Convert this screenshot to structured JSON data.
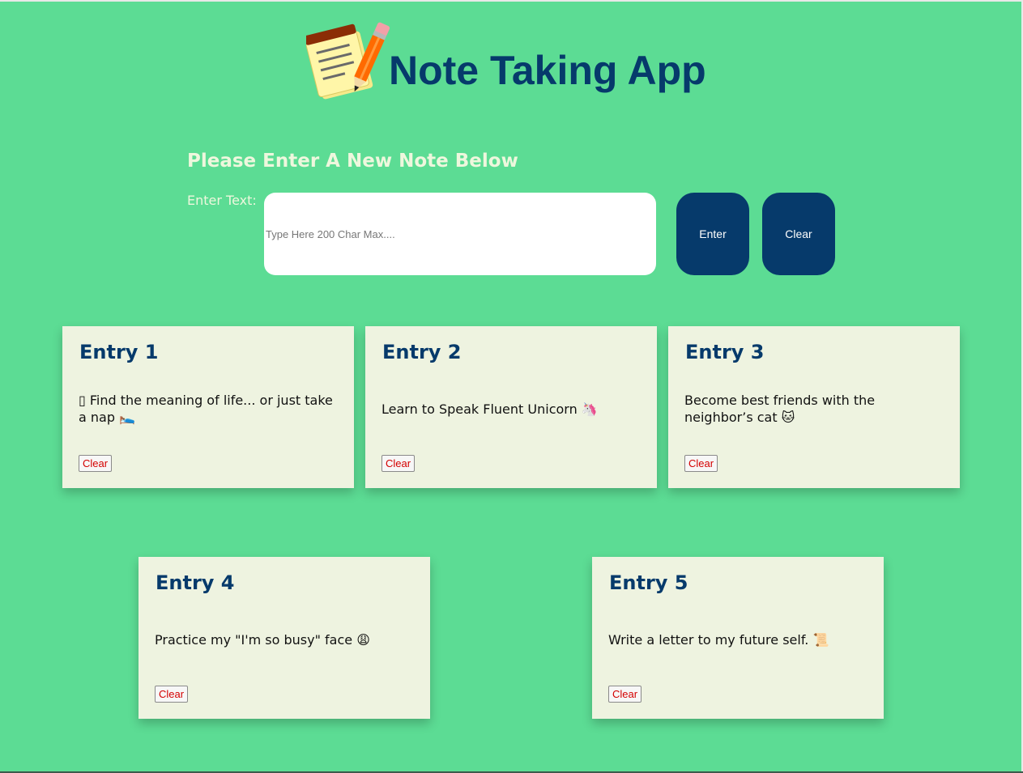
{
  "app": {
    "title": "Note Taking App",
    "logo_icon": "notepad-pencil-icon"
  },
  "form": {
    "prompt": "Please Enter A New Note Below",
    "label": "Enter Text:",
    "placeholder": "Type Here 200 Char Max....",
    "value": "",
    "enter_label": "Enter",
    "clear_label": "Clear"
  },
  "colors": {
    "background": "#5cdc94",
    "accent": "#063a6b",
    "card": "#eef3e0",
    "danger": "#d40000"
  },
  "entries": [
    {
      "title": "Entry 1",
      "text": "▯ Find the meaning of life... or just take a nap 🛌",
      "clear_label": "Clear"
    },
    {
      "title": "Entry 2",
      "text": "Learn to Speak Fluent Unicorn 🦄",
      "clear_label": "Clear"
    },
    {
      "title": "Entry 3",
      "text": "Become best friends with the neighbor’s cat 🐱",
      "clear_label": "Clear"
    },
    {
      "title": "Entry 4",
      "text": "Practice my \"I'm so busy\" face 😩",
      "clear_label": "Clear"
    },
    {
      "title": "Entry 5",
      "text": "Write a letter to my future self. 📜",
      "clear_label": "Clear"
    }
  ]
}
